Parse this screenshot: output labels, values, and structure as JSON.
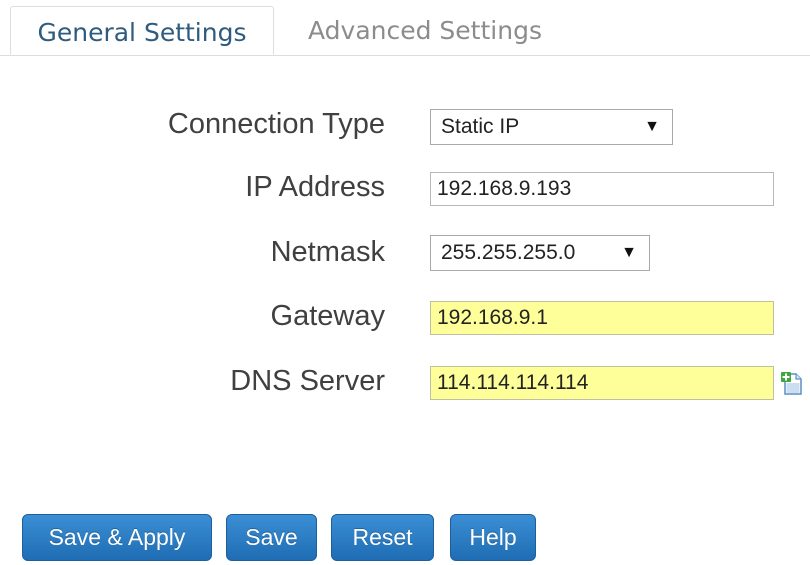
{
  "tabs": [
    {
      "label": "General Settings",
      "active": true
    },
    {
      "label": "Advanced Settings",
      "active": false
    }
  ],
  "form": {
    "connection_type": {
      "label": "Connection Type",
      "value": "Static IP"
    },
    "ip_address": {
      "label": "IP Address",
      "value": "192.168.9.193"
    },
    "netmask": {
      "label": "Netmask",
      "value": "255.255.255.0"
    },
    "gateway": {
      "label": "Gateway",
      "value": "192.168.9.1"
    },
    "dns_server": {
      "label": "DNS Server",
      "value": "114.114.114.114"
    }
  },
  "buttons": {
    "save_apply": "Save & Apply",
    "save": "Save",
    "reset": "Reset",
    "help": "Help"
  },
  "colors": {
    "button": "#2a7cc7",
    "highlight_field": "#ffff99",
    "active_tab_text": "#2f5c7e"
  },
  "icons": {
    "dropdown": "dropdown-arrow-icon",
    "add_dns": "add-document-icon"
  }
}
